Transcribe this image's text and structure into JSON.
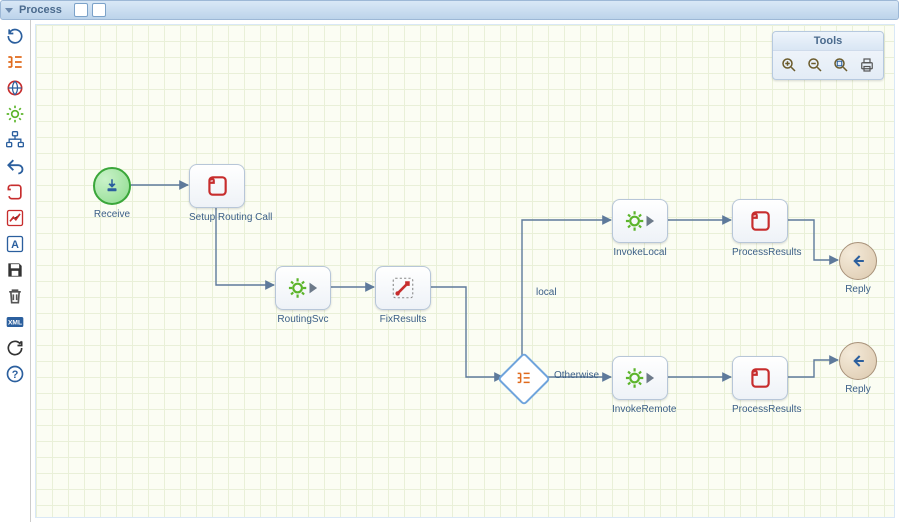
{
  "header": {
    "title": "Process"
  },
  "tools_panel": {
    "title": "Tools"
  },
  "nodes": {
    "receive": {
      "label": "Receive"
    },
    "setup": {
      "label": "Setup Routing Call"
    },
    "routing": {
      "label": "RoutingSvc"
    },
    "fix": {
      "label": "FixResults"
    },
    "invoke_local": {
      "label": "InvokeLocal"
    },
    "process_results_top": {
      "label": "ProcessResults"
    },
    "reply_top": {
      "label": "Reply"
    },
    "invoke_remote": {
      "label": "InvokeRemote"
    },
    "process_results_bottom": {
      "label": "ProcessResults"
    },
    "reply_bottom": {
      "label": "Reply"
    }
  },
  "edges": {
    "branch_local": {
      "label": "local"
    },
    "branch_otherwise": {
      "label": "Otherwise"
    }
  },
  "palette": {
    "items": [
      {
        "name": "refresh-icon"
      },
      {
        "name": "tree-icon"
      },
      {
        "name": "globe-icon"
      },
      {
        "name": "gear-icon"
      },
      {
        "name": "hierarchy-icon"
      },
      {
        "name": "undo-icon"
      },
      {
        "name": "script-icon"
      },
      {
        "name": "chart-icon"
      },
      {
        "name": "text-icon"
      },
      {
        "name": "save-icon"
      },
      {
        "name": "trash-icon"
      },
      {
        "name": "xml-icon"
      },
      {
        "name": "reload-icon"
      },
      {
        "name": "help-icon"
      }
    ]
  },
  "tools": {
    "buttons": [
      {
        "name": "zoom-in-icon"
      },
      {
        "name": "zoom-out-icon"
      },
      {
        "name": "fit-icon"
      },
      {
        "name": "print-icon"
      }
    ]
  },
  "colors": {
    "accent_blue": "#2b5f9e",
    "accent_red": "#c72d2d",
    "accent_green": "#5cb52b",
    "accent_orange": "#e06a1c"
  }
}
